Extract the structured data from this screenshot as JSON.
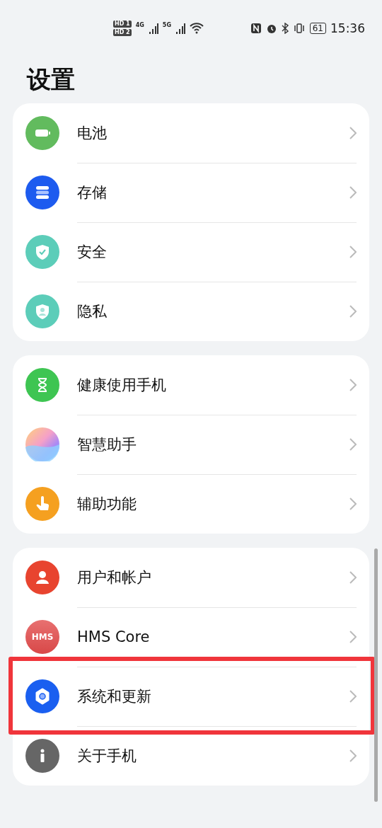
{
  "status_bar": {
    "sim_1": "HD 1",
    "sim_2": "HD 2",
    "network_1": "4G",
    "network_2": "5G",
    "battery": "61",
    "time": "15:36"
  },
  "title": "设置",
  "groups": [
    {
      "items": [
        {
          "label": "电池",
          "highlighted": false
        },
        {
          "label": "存储",
          "highlighted": false
        },
        {
          "label": "安全",
          "highlighted": false
        },
        {
          "label": "隐私",
          "highlighted": false
        }
      ]
    },
    {
      "items": [
        {
          "label": "健康使用手机",
          "highlighted": false
        },
        {
          "label": "智慧助手",
          "highlighted": false
        },
        {
          "label": "辅助功能",
          "highlighted": false
        }
      ]
    },
    {
      "items": [
        {
          "label": "用户和帐户",
          "highlighted": false
        },
        {
          "label": "HMS Core",
          "badge": "HMS",
          "highlighted": false
        },
        {
          "label": "系统和更新",
          "highlighted": true
        },
        {
          "label": "关于手机",
          "highlighted": false
        }
      ]
    }
  ]
}
